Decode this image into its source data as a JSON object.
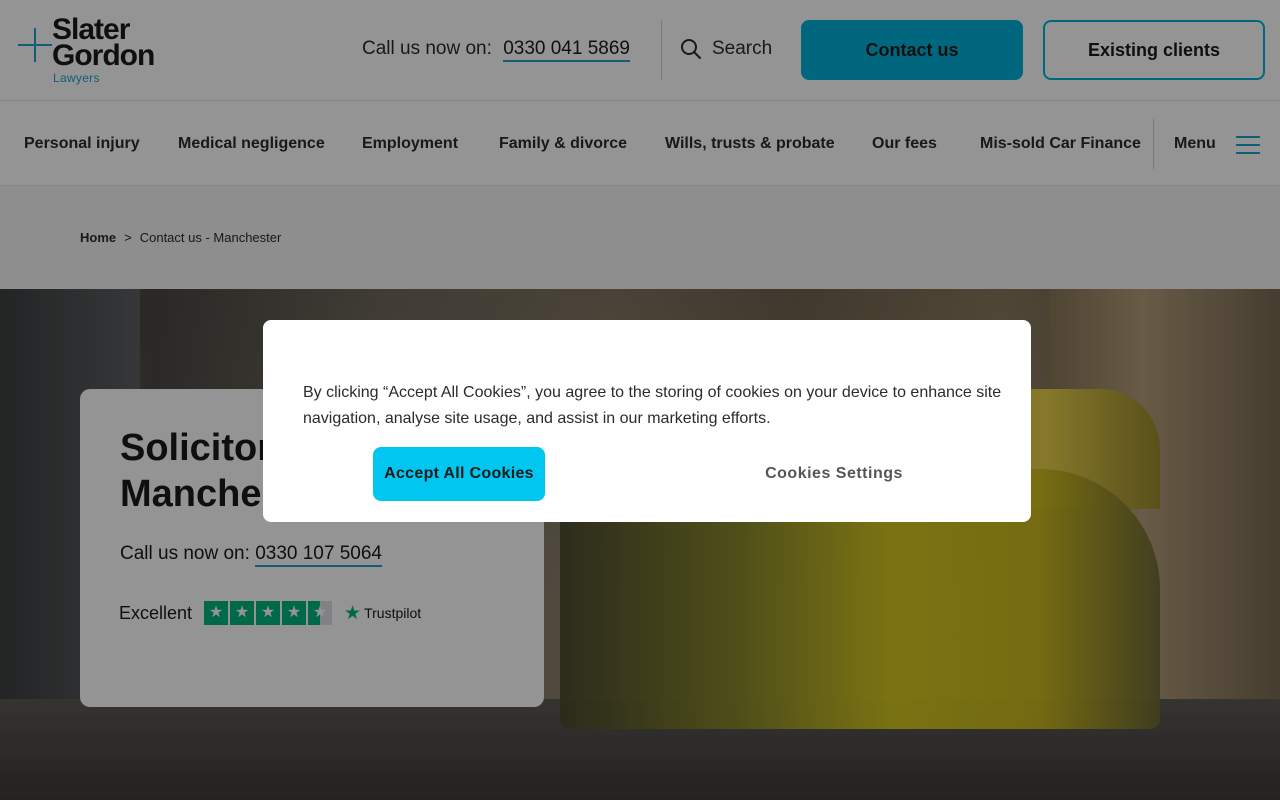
{
  "header": {
    "logo_line1": "Slater",
    "logo_line2": "Gordon",
    "logo_line3": "Lawyers",
    "call_label": "Call us now on:",
    "call_number": "0330 041 5869",
    "search_label": "Search",
    "contact_button": "Contact us",
    "existing_button": "Existing clients"
  },
  "nav": {
    "items": [
      {
        "label": "Personal injury"
      },
      {
        "label": "Medical negligence"
      },
      {
        "label": "Employment"
      },
      {
        "label": "Family & divorce"
      },
      {
        "label": "Wills, trusts & probate"
      },
      {
        "label": "Our fees"
      },
      {
        "label": "Mis-sold Car Finance"
      }
    ],
    "menu_label": "Menu"
  },
  "breadcrumb": {
    "home": "Home",
    "separator": ">",
    "current": "Contact us - Manchester"
  },
  "hero": {
    "title": "Solicitors in Manchester",
    "call_label": "Call us now on:",
    "call_number": "0330 107 5064",
    "trustpilot_label": "Excellent",
    "trustpilot_rating": 4.5,
    "trustpilot_brand": "Trustpilot"
  },
  "cookie": {
    "text": "By clicking “Accept All Cookies”, you agree to the storing of cookies on your device to enhance site navigation, analyse site usage, and assist in our marketing efforts.",
    "accept_button": "Accept All Cookies",
    "settings_button": "Cookies Settings"
  },
  "colors": {
    "accent": "#00b2d9",
    "logo_accent": "#1aa3c8",
    "trustpilot_green": "#00b67a"
  }
}
